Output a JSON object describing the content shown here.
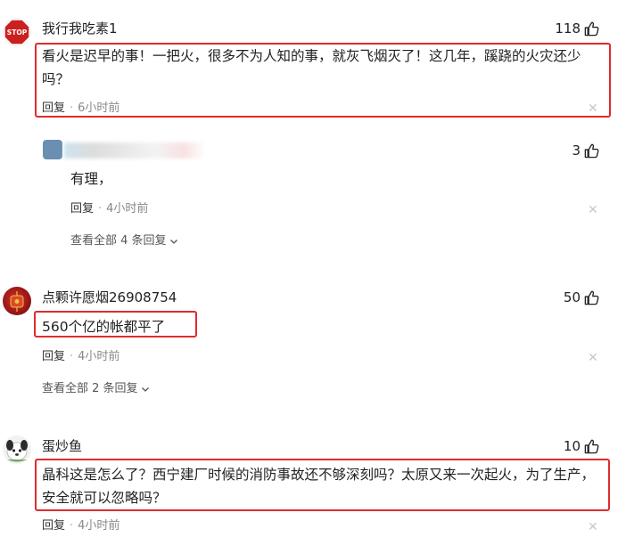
{
  "comments": [
    {
      "username": "我行我吃素1",
      "likes": "118",
      "text": "看火是迟早的事！一把火，很多不为人知的事，就灰飞烟灭了！这几年，蹊跷的火灾还少吗？",
      "reply_label": "回复",
      "time": "6小时前"
    },
    {
      "username": "点颗许愿烟26908754",
      "likes": "50",
      "text": "560个亿的帐都平了",
      "reply_label": "回复",
      "time": "4小时前",
      "view_all": "查看全部 2 条回复"
    },
    {
      "username": "蛋炒鱼",
      "likes": "10",
      "text": "晶科这是怎么了？西宁建厂时候的消防事故还不够深刻吗？太原又来一次起火，为了生产，安全就可以忽略吗？",
      "reply_label": "回复",
      "time": "4小时前"
    }
  ],
  "reply": {
    "likes": "3",
    "text": "有理，",
    "reply_label": "回复",
    "time": "4小时前",
    "view_all": "查看全部 4 条回复"
  },
  "avatar_stop_label": "STOP",
  "colors": {
    "highlight": "#e12b2b",
    "stop_sign": "#cc1f1f"
  }
}
